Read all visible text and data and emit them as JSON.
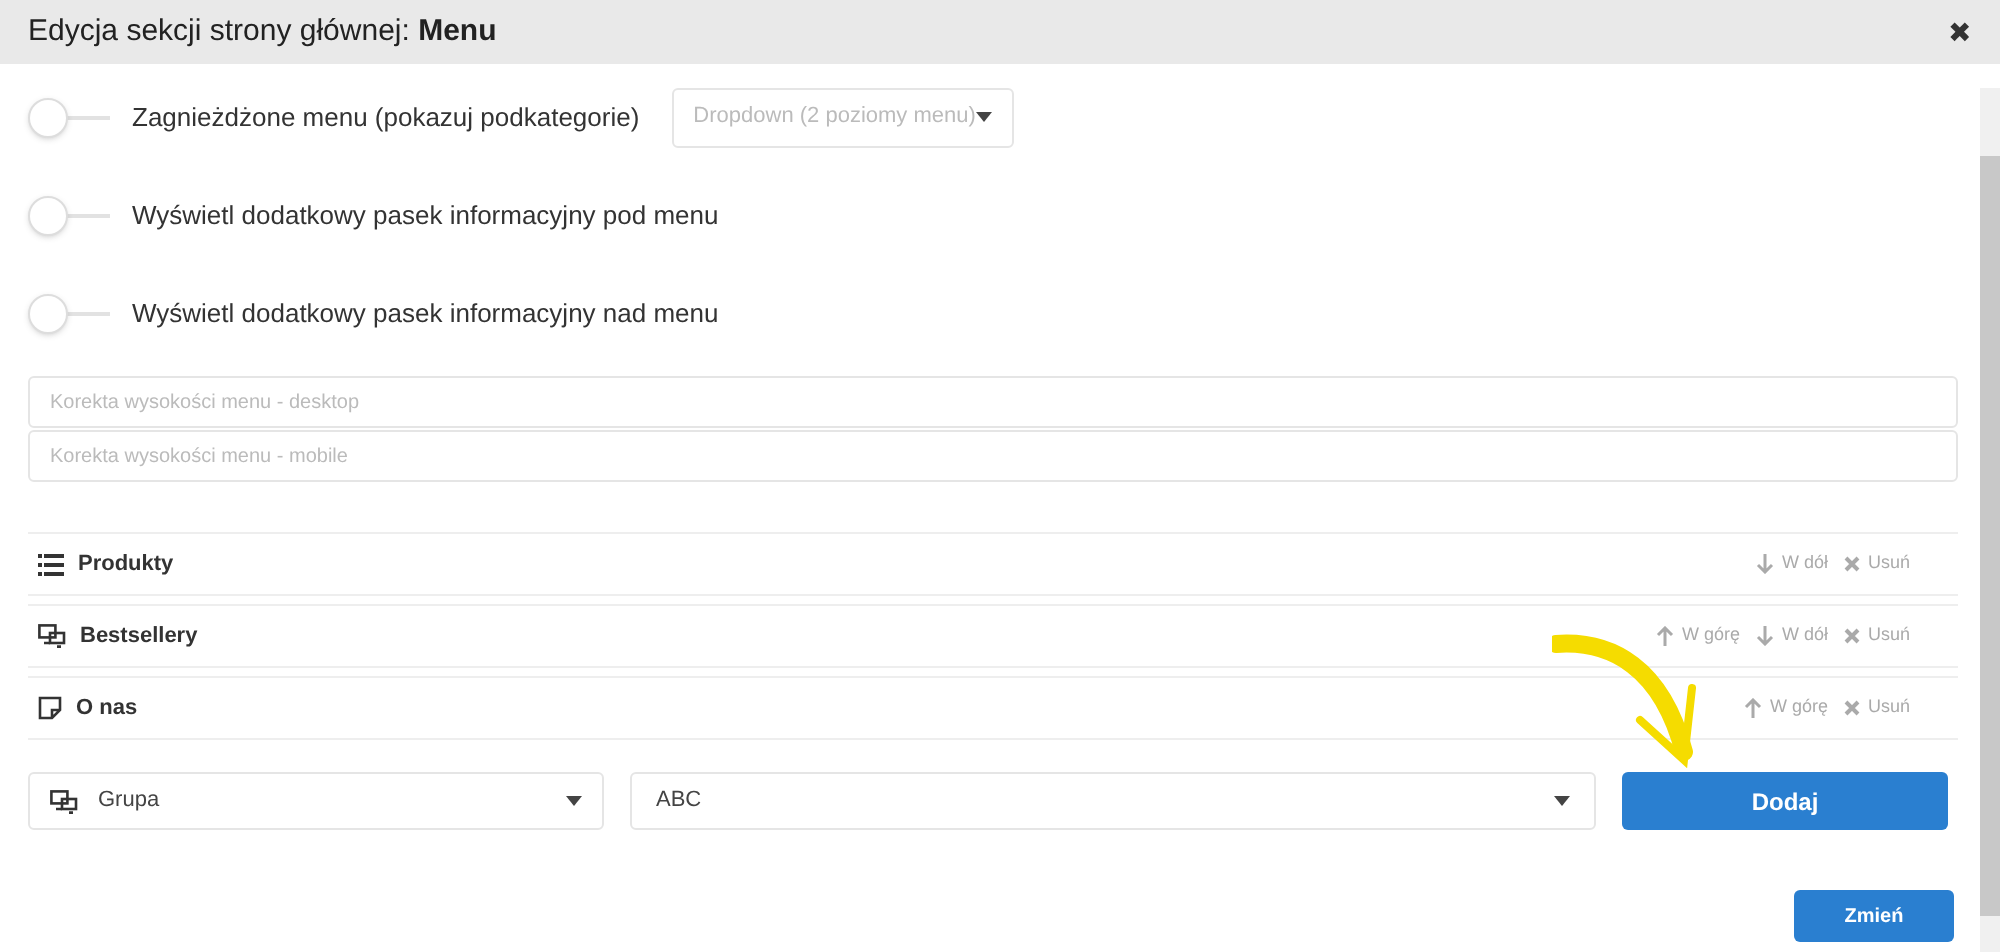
{
  "window": {
    "title_prefix": "Edycja sekcji strony głównej: ",
    "title_bold": "Menu",
    "close": "✖"
  },
  "toggles": [
    {
      "label": "Zagnieżdżone menu (pokazuj podkategorie)",
      "on": false,
      "select": "Dropdown (2 poziomy menu)"
    },
    {
      "label": "Wyświetl dodatkowy pasek informacyjny pod menu",
      "on": false
    },
    {
      "label": "Wyświetl dodatkowy pasek informacyjny nad menu",
      "on": false
    }
  ],
  "fields": [
    {
      "placeholder": "Korekta wysokości menu - desktop"
    },
    {
      "placeholder": "Korekta wysokości menu - mobile"
    }
  ],
  "items": [
    {
      "kind": "list",
      "label": "Produkty",
      "actions": [
        {
          "kind": "down",
          "label": "W dół"
        },
        {
          "kind": "remove",
          "label": "Usuń"
        }
      ]
    },
    {
      "kind": "group",
      "label": "Bestsellery",
      "actions": [
        {
          "kind": "up",
          "label": "W górę"
        },
        {
          "kind": "down",
          "label": "W dół"
        },
        {
          "kind": "remove",
          "label": "Usuń"
        }
      ]
    },
    {
      "kind": "page",
      "label": "O nas",
      "actions": [
        {
          "kind": "up",
          "label": "W górę"
        },
        {
          "kind": "remove",
          "label": "Usuń"
        }
      ]
    }
  ],
  "add_row": {
    "type_select": "Grupa",
    "value_select": "ABC",
    "add_button": "Dodaj"
  },
  "save_button": "Zmień"
}
